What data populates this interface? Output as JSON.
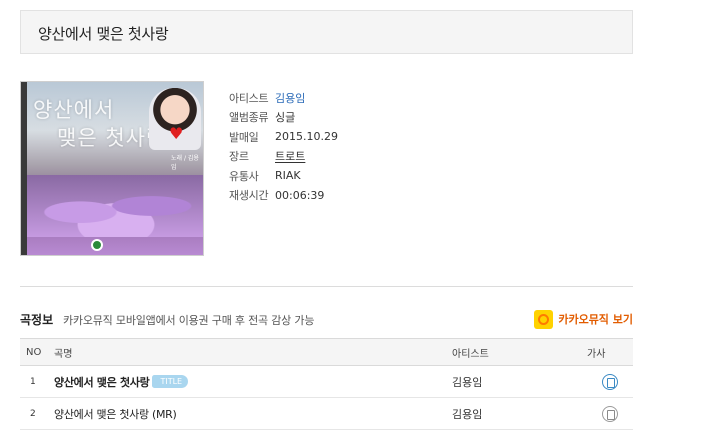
{
  "album": {
    "title": "양산에서 맺은 첫사랑",
    "cover": {
      "calligraphy_line1": "양산에서",
      "calligraphy_line2": "맺은 첫사랑",
      "credit": "노래 / 김용임"
    }
  },
  "meta": [
    {
      "label": "아티스트",
      "value": "김용임",
      "style": "link"
    },
    {
      "label": "앨범종류",
      "value": "싱글",
      "style": "plain"
    },
    {
      "label": "발매일",
      "value": "2015.10.29",
      "style": "plain"
    },
    {
      "label": "장르",
      "value": "트로트",
      "style": "underline"
    },
    {
      "label": "유통사",
      "value": "RIAK",
      "style": "plain"
    },
    {
      "label": "재생시간",
      "value": "00:06:39",
      "style": "plain"
    }
  ],
  "tracklist": {
    "section_label": "곡정보",
    "note": "카카오뮤직 모바일앱에서 이용권 구매 후 전곡 감상 가능",
    "kakao_button_label": "카카오뮤직 보기",
    "kakao_icon": "kakao-music-icon",
    "columns": {
      "no": "NO",
      "title": "곡명",
      "artist": "아티스트",
      "lyrics": "가사"
    },
    "tracks": [
      {
        "no": "1",
        "title": "양산에서 맺은 첫사랑",
        "badge": "TITLE",
        "artist": "김용임",
        "lyrics_icon": "lyrics-icon"
      },
      {
        "no": "2",
        "title": "양산에서 맺은 첫사랑 (MR)",
        "badge": "",
        "artist": "김용임",
        "lyrics_icon": "lyrics-icon"
      }
    ]
  },
  "colors": {
    "link": "#2b6bb8",
    "kakao": "#e25c00",
    "kakao_bg": "#ffd200",
    "badge": "#a9d6ef"
  }
}
